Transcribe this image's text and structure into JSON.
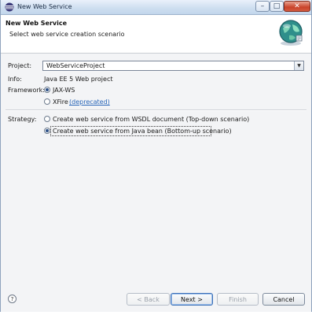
{
  "window": {
    "title": "New Web Service"
  },
  "banner": {
    "title": "New Web Service",
    "description": "Select web service creation scenario"
  },
  "form": {
    "project_label": "Project:",
    "project_value": "WebServiceProject",
    "info_label": "Info:",
    "info_value": "Java EE 5 Web project",
    "framework_label": "Framework:",
    "framework_options": [
      {
        "label": "JAX-WS",
        "selected": true
      },
      {
        "label": "XFire",
        "link": "(deprecated)",
        "selected": false
      }
    ],
    "strategy_label": "Strategy:",
    "strategy_options": [
      {
        "label": "Create web service from WSDL document (Top-down scenario)",
        "selected": false
      },
      {
        "label": "Create web service from Java bean (Bottom-up scenario)",
        "selected": true
      }
    ]
  },
  "buttons": {
    "help": "?",
    "back": "< Back",
    "next": "Next >",
    "finish": "Finish",
    "cancel": "Cancel"
  },
  "colors": {
    "link": "#2966b8",
    "title_bar": "#cfdff0",
    "accent_radio": "#2b4f86"
  }
}
